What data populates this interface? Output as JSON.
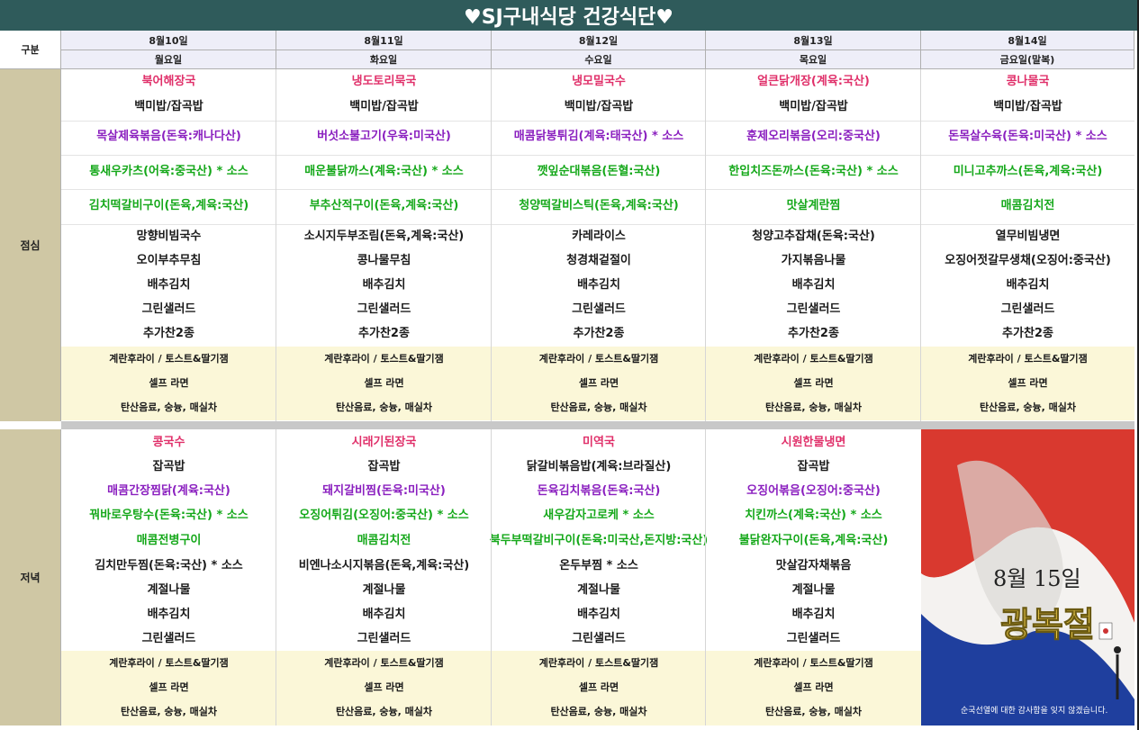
{
  "title": "♥SJ구내식당 건강식단♥",
  "header": {
    "category_label": "구분",
    "dates": [
      "8월10일",
      "8월11일",
      "8월12일",
      "8월13일",
      "8월14일"
    ],
    "days": [
      "월요일",
      "화요일",
      "수요일",
      "목요일",
      "금요일(말복)"
    ]
  },
  "lunch": {
    "label": "점심",
    "days": [
      {
        "items": [
          {
            "text": "북어해장국",
            "color": "red"
          },
          {
            "text": "백미밥/잡곡밥",
            "color": "black"
          },
          {
            "text": "목살제육볶음(돈육:캐나다산)",
            "color": "purple"
          },
          {
            "text": "통새우카츠(어육:중국산) * 소스",
            "color": "green"
          },
          {
            "text": "김치떡갈비구이(돈육,계육:국산)",
            "color": "green"
          },
          {
            "text": "망향비빔국수",
            "color": "black"
          },
          {
            "text": "오이부추무침",
            "color": "black"
          },
          {
            "text": "배추김치",
            "color": "black"
          },
          {
            "text": "그린샐러드",
            "color": "black"
          },
          {
            "text": "추가찬2종",
            "color": "black"
          }
        ]
      },
      {
        "items": [
          {
            "text": "냉도토리묵국",
            "color": "red"
          },
          {
            "text": "백미밥/잡곡밥",
            "color": "black"
          },
          {
            "text": "버섯소불고기(우육:미국산)",
            "color": "purple"
          },
          {
            "text": "매운불닭까스(계육:국산) * 소스",
            "color": "green"
          },
          {
            "text": "부추산적구이(돈육,계육:국산)",
            "color": "green"
          },
          {
            "text": "소시지두부조림(돈육,계육:국산)",
            "color": "black"
          },
          {
            "text": "콩나물무침",
            "color": "black"
          },
          {
            "text": "배추김치",
            "color": "black"
          },
          {
            "text": "그린샐러드",
            "color": "black"
          },
          {
            "text": "추가찬2종",
            "color": "black"
          }
        ]
      },
      {
        "items": [
          {
            "text": "냉모밀국수",
            "color": "red"
          },
          {
            "text": "백미밥/잡곡밥",
            "color": "black"
          },
          {
            "text": "매콤닭봉튀김(계육:태국산) * 소스",
            "color": "purple"
          },
          {
            "text": "깻잎순대볶음(돈혈:국산)",
            "color": "green"
          },
          {
            "text": "청양떡갈비스틱(돈육,계육:국산)",
            "color": "green"
          },
          {
            "text": "카레라이스",
            "color": "black"
          },
          {
            "text": "청경채겉절이",
            "color": "black"
          },
          {
            "text": "배추김치",
            "color": "black"
          },
          {
            "text": "그린샐러드",
            "color": "black"
          },
          {
            "text": "추가찬2종",
            "color": "black"
          }
        ]
      },
      {
        "items": [
          {
            "text": "얼큰닭개장(계육:국산)",
            "color": "red"
          },
          {
            "text": "백미밥/잡곡밥",
            "color": "black"
          },
          {
            "text": "훈제오리볶음(오리:중국산)",
            "color": "purple"
          },
          {
            "text": "한입치즈돈까스(돈육:국산) * 소스",
            "color": "green"
          },
          {
            "text": "맛살계란찜",
            "color": "green"
          },
          {
            "text": "청양고추잡채(돈육:국산)",
            "color": "black"
          },
          {
            "text": "가지볶음나물",
            "color": "black"
          },
          {
            "text": "배추김치",
            "color": "black"
          },
          {
            "text": "그린샐러드",
            "color": "black"
          },
          {
            "text": "추가찬2종",
            "color": "black"
          }
        ]
      },
      {
        "items": [
          {
            "text": "콩나물국",
            "color": "red"
          },
          {
            "text": "백미밥/잡곡밥",
            "color": "black"
          },
          {
            "text": "돈목살수육(돈육:미국산) * 소스",
            "color": "purple"
          },
          {
            "text": "미니고추까스(돈육,계육:국산)",
            "color": "green"
          },
          {
            "text": "매콤김치전",
            "color": "green"
          },
          {
            "text": "열무비빔냉면",
            "color": "black"
          },
          {
            "text": "오징어젓갈무생채(오징어:중국산)",
            "color": "black"
          },
          {
            "text": "배추김치",
            "color": "black"
          },
          {
            "text": "그린샐러드",
            "color": "black"
          },
          {
            "text": "추가찬2종",
            "color": "black"
          }
        ]
      }
    ]
  },
  "dinner": {
    "label": "저녁",
    "days": [
      {
        "items": [
          {
            "text": "콩국수",
            "color": "red"
          },
          {
            "text": "잡곡밥",
            "color": "black"
          },
          {
            "text": "매콤간장찜닭(계육:국산)",
            "color": "purple"
          },
          {
            "text": "꿔바로우탕수(돈육:국산) * 소스",
            "color": "green"
          },
          {
            "text": "매콤전병구이",
            "color": "green"
          },
          {
            "text": "김치만두찜(돈육:국산) * 소스",
            "color": "black"
          },
          {
            "text": "계절나물",
            "color": "black"
          },
          {
            "text": "배추김치",
            "color": "black"
          },
          {
            "text": "그린샐러드",
            "color": "black"
          }
        ]
      },
      {
        "items": [
          {
            "text": "시래기된장국",
            "color": "red"
          },
          {
            "text": "잡곡밥",
            "color": "black"
          },
          {
            "text": "돼지갈비찜(돈육:미국산)",
            "color": "purple"
          },
          {
            "text": "오징어튀김(오징어:중국산) * 소스",
            "color": "green"
          },
          {
            "text": "매콤김치전",
            "color": "green"
          },
          {
            "text": "비엔나소시지볶음(돈육,계육:국산)",
            "color": "black"
          },
          {
            "text": "계절나물",
            "color": "black"
          },
          {
            "text": "배추김치",
            "color": "black"
          },
          {
            "text": "그린샐러드",
            "color": "black"
          }
        ]
      },
      {
        "items": [
          {
            "text": "미역국",
            "color": "red"
          },
          {
            "text": "닭갈비볶음밥(계육:브라질산)",
            "color": "black"
          },
          {
            "text": "돈육김치볶음(돈육:국산)",
            "color": "purple"
          },
          {
            "text": "새우감자고로케 * 소스",
            "color": "green"
          },
          {
            "text": "북두부떡갈비구이(돈육:미국산,돈지방:국산)",
            "color": "green"
          },
          {
            "text": "온두부찜 * 소스",
            "color": "black"
          },
          {
            "text": "계절나물",
            "color": "black"
          },
          {
            "text": "배추김치",
            "color": "black"
          },
          {
            "text": "그린샐러드",
            "color": "black"
          }
        ]
      },
      {
        "items": [
          {
            "text": "시원한물냉면",
            "color": "red"
          },
          {
            "text": "잡곡밥",
            "color": "black"
          },
          {
            "text": "오징어볶음(오징어:중국산)",
            "color": "purple"
          },
          {
            "text": "치킨까스(계육:국산) * 소스",
            "color": "green"
          },
          {
            "text": "불닭완자구이(돈육,계육:국산)",
            "color": "green"
          },
          {
            "text": "맛살감자채볶음",
            "color": "black"
          },
          {
            "text": "계절나물",
            "color": "black"
          },
          {
            "text": "배추김치",
            "color": "black"
          },
          {
            "text": "그린샐러드",
            "color": "black"
          }
        ]
      }
    ]
  },
  "extras": [
    "계란후라이 / 토스트&딸기잼",
    "셀프 라면",
    "탄산음료, 숭늉, 매실차"
  ],
  "banner": {
    "date": "8월 15일",
    "title": "광복절",
    "caption": "순국선열에 대한 감사함을 잊지 않겠습니다."
  },
  "colors": {
    "red": "#e0306a",
    "purple": "#8a1fbf",
    "green": "#15a81a",
    "black": "#1a1a1a",
    "title_bar": "#2f5b5b",
    "category": "#cfc7a4",
    "extras_bg": "#fbf7d8"
  }
}
